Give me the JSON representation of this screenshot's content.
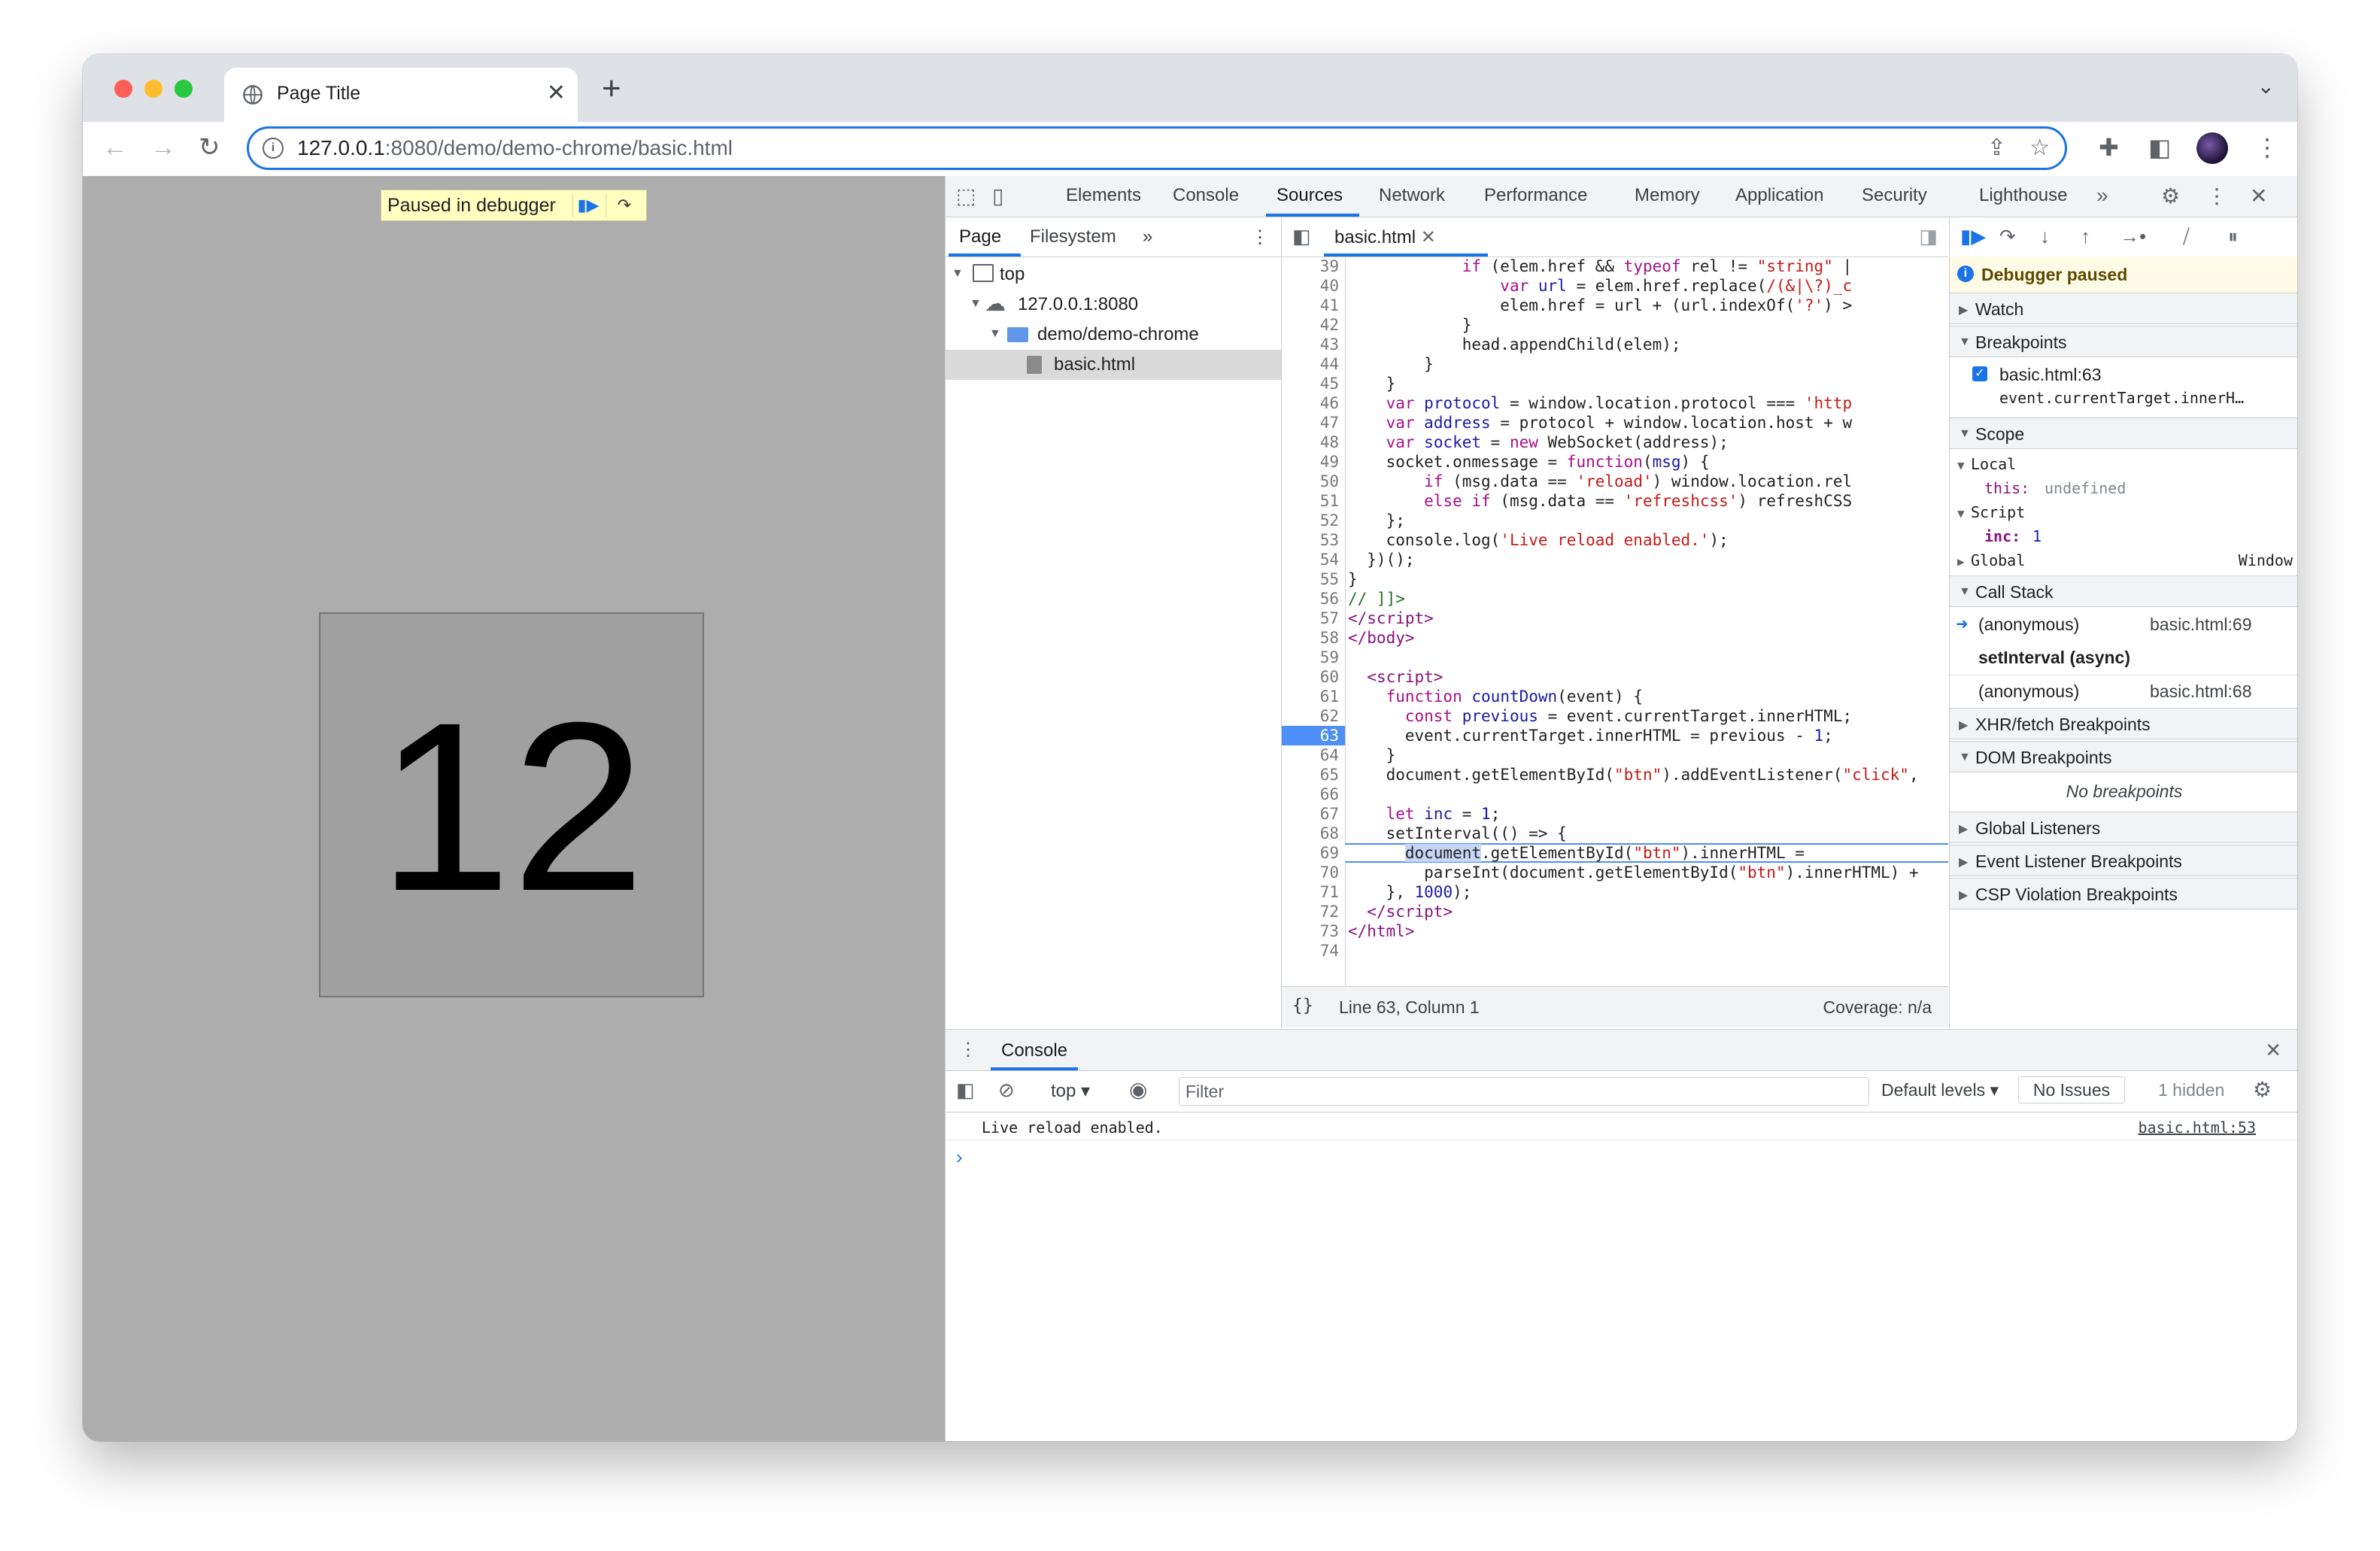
{
  "tab": {
    "title": "Page Title",
    "close": "✕"
  },
  "address": {
    "host": "127.0.0.1",
    "path": ":8080/demo/demo-chrome/basic.html"
  },
  "page": {
    "paused_label": "Paused in debugger",
    "counter": "12"
  },
  "devtools": {
    "tabs": [
      "Elements",
      "Console",
      "Sources",
      "Network",
      "Performance",
      "Memory",
      "Application",
      "Security",
      "Lighthouse"
    ],
    "active_tab": "Sources",
    "navigator": {
      "tabs": [
        "Page",
        "Filesystem"
      ],
      "tree": [
        "top",
        "127.0.0.1:8080",
        "demo/demo-chrome",
        "basic.html"
      ]
    },
    "editor": {
      "file_tab": "basic.html",
      "status_position": "Line 63, Column 1",
      "status_coverage": "Coverage: n/a",
      "breakpoint_line": 63,
      "exec_line": 69
    },
    "sidebar": {
      "paused": "Debugger paused",
      "watch": "Watch",
      "breakpoints": "Breakpoints",
      "bp_file": "basic.html:63",
      "bp_code": "event.currentTarget.innerH…",
      "scope": "Scope",
      "local": "Local",
      "this_key": "this:",
      "this_val": "undefined",
      "script": "Script",
      "inc_key": "inc:",
      "inc_val": "1",
      "global": "Global",
      "global_val": "Window",
      "call_stack": "Call Stack",
      "frames": [
        {
          "name": "(anonymous)",
          "loc": "basic.html:69"
        },
        {
          "name": "setInterval (async)",
          "loc": ""
        },
        {
          "name": "(anonymous)",
          "loc": "basic.html:68"
        }
      ],
      "xhr": "XHR/fetch Breakpoints",
      "dom": "DOM Breakpoints",
      "no_bp": "No breakpoints",
      "global_listeners": "Global Listeners",
      "event_listener": "Event Listener Breakpoints",
      "csp": "CSP Violation Breakpoints"
    },
    "drawer": {
      "title": "Console",
      "context": "top",
      "filter_placeholder": "Filter",
      "levels": "Default levels ▾",
      "issues": "No Issues",
      "hidden": "1 hidden",
      "log_message": "Live reload enabled.",
      "log_source": "basic.html:53",
      "prompt": "›"
    }
  }
}
